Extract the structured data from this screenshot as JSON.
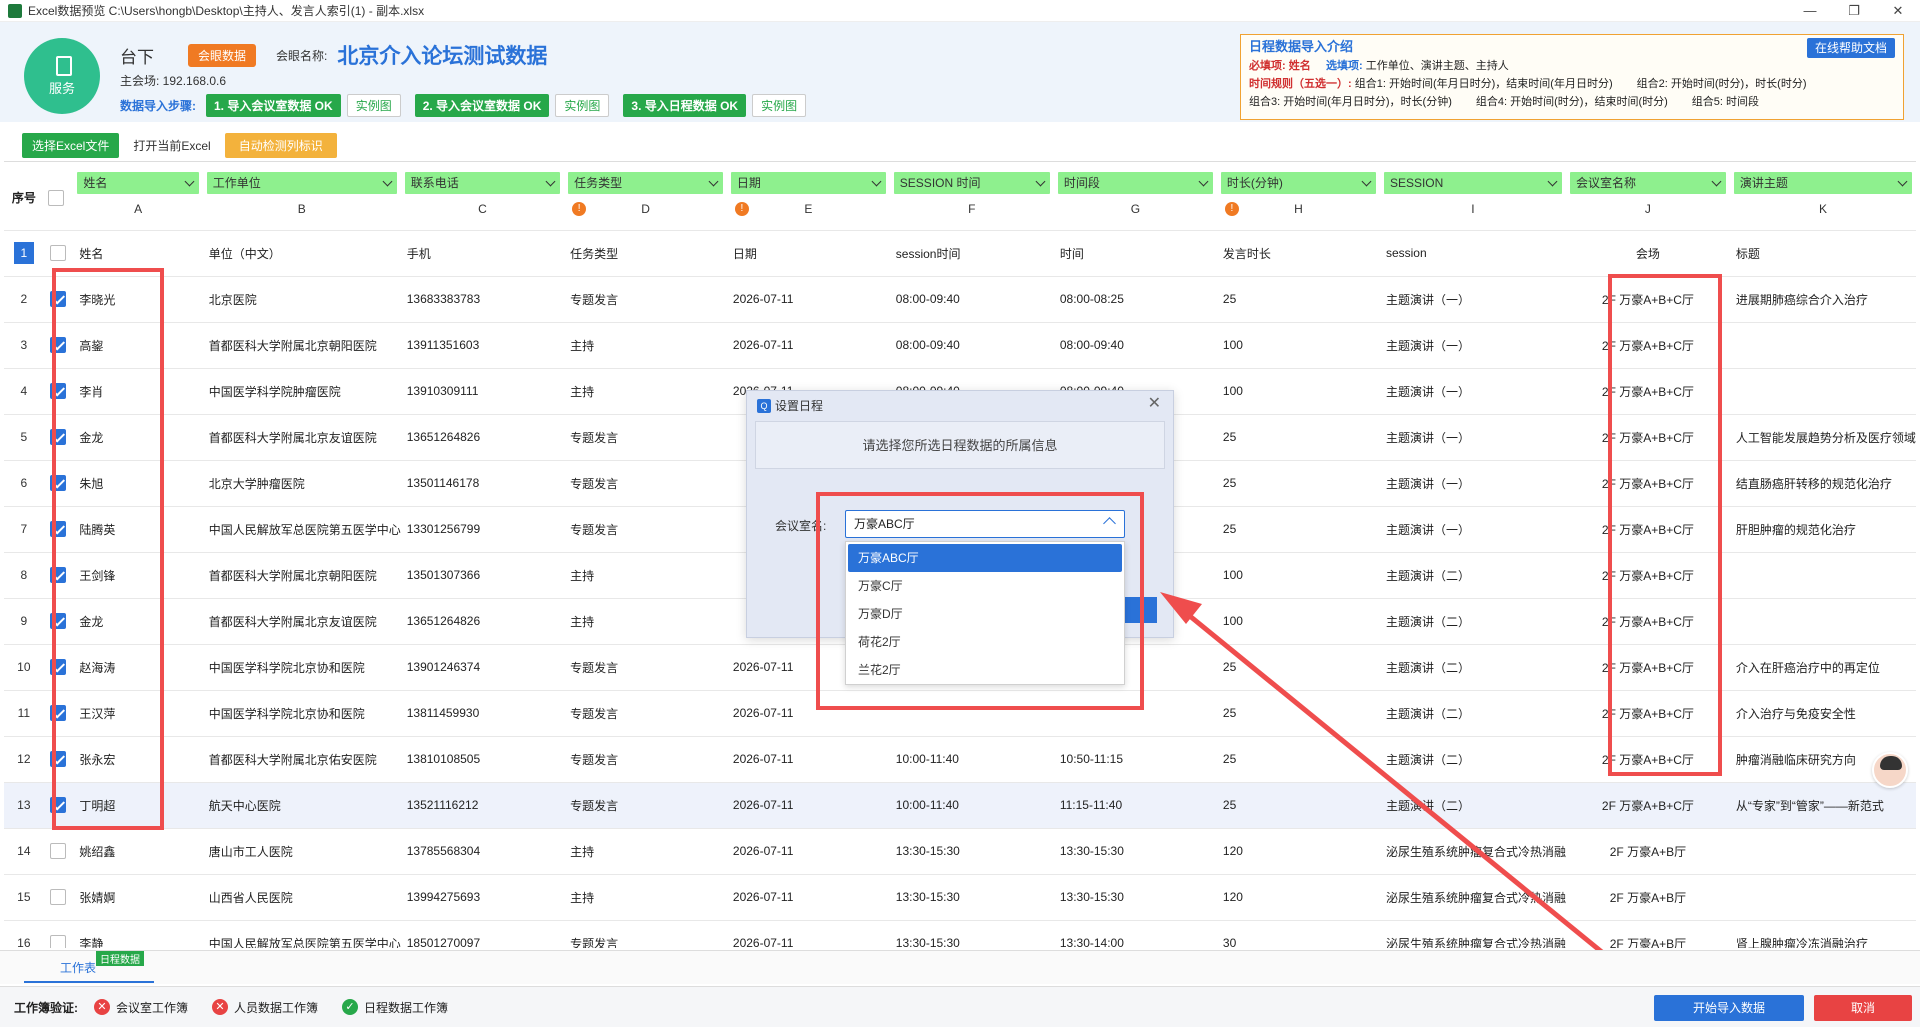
{
  "titlebar": {
    "title": "Excel数据预览 C:\\Users\\hongb\\Desktop\\主持人、发言人索引(1) - 副本.xlsx",
    "min": "—",
    "max": "❐",
    "close": "✕"
  },
  "header": {
    "service": "服务",
    "stage": "台下",
    "tag": "会眼数据",
    "conf_label": "会眼名称:",
    "conf_name": "北京介入论坛测试数据",
    "host": "主会场: 192.168.0.6",
    "steps_label": "数据导入步骤:",
    "step1": "1. 导入会议室数据 OK",
    "step2": "2. 导入会议室数据 OK",
    "step3": "3. 导入日程数据 OK",
    "example": "实例图"
  },
  "intro": {
    "title": "日程数据导入介绍",
    "help": "在线帮助文档",
    "req_label": "必填项:",
    "req": "姓名",
    "opt_label": "选填项:",
    "opt": "工作单位、演讲主题、主持人",
    "rule_label": "时间规则（五选一）:",
    "c1": "组合1: 开始时间(年月日时分)，结束时间(年月日时分)",
    "c2": "组合2: 开始时间(时分)，时长(时分)",
    "c3": "组合3: 开始时间(年月日时分)，时长(分钟)",
    "c4": "组合4: 开始时间(时分)，结束时间(时分)",
    "c5": "组合5: 时间段"
  },
  "toolbar": {
    "select_excel": "选择Excel文件",
    "open_excel": "打开当前Excel",
    "auto_detect": "自动检测列标识"
  },
  "table": {
    "seq_header": "序号",
    "columns": [
      {
        "field": "姓名",
        "letter": "A",
        "warn": false
      },
      {
        "field": "工作单位",
        "letter": "B",
        "warn": false
      },
      {
        "field": "联系电话",
        "letter": "C",
        "warn": false
      },
      {
        "field": "任务类型",
        "letter": "D",
        "warn": true
      },
      {
        "field": "日期",
        "letter": "E",
        "warn": true
      },
      {
        "field": "SESSION 时间",
        "letter": "F",
        "warn": false
      },
      {
        "field": "时间段",
        "letter": "G",
        "warn": false
      },
      {
        "field": "时长(分钟)",
        "letter": "H",
        "warn": true
      },
      {
        "field": "SESSION",
        "letter": "I",
        "warn": false
      },
      {
        "field": "会议室名称",
        "letter": "J",
        "warn": false
      },
      {
        "field": "演讲主题",
        "letter": "K",
        "warn": false
      }
    ],
    "rows": [
      {
        "n": "1",
        "checked": false,
        "cells": [
          "姓名",
          "单位（中文）",
          "手机",
          "任务类型",
          "日期",
          "session时间",
          "时间",
          "发言时长",
          "session",
          "会场",
          "标题"
        ]
      },
      {
        "n": "2",
        "checked": true,
        "cells": [
          "李晓光",
          "北京医院",
          "13683383783",
          "专题发言",
          "2026-07-11",
          "08:00-09:40",
          "08:00-08:25",
          "25",
          "主题演讲（一）",
          "2F 万豪A+B+C厅",
          "进展期肺癌综合介入治疗"
        ]
      },
      {
        "n": "3",
        "checked": true,
        "cells": [
          "高鋆",
          "首都医科大学附属北京朝阳医院",
          "13911351603",
          "主持",
          "2026-07-11",
          "08:00-09:40",
          "08:00-09:40",
          "100",
          "主题演讲（一）",
          "2F 万豪A+B+C厅",
          ""
        ]
      },
      {
        "n": "4",
        "checked": true,
        "cells": [
          "李肖",
          "中国医学科学院肿瘤医院",
          "13910309111",
          "主持",
          "2026-07-11",
          "08:00-09:40",
          "08:00-09:40",
          "100",
          "主题演讲（一）",
          "2F 万豪A+B+C厅",
          ""
        ]
      },
      {
        "n": "5",
        "checked": true,
        "cells": [
          "金龙",
          "首都医科大学附属北京友谊医院",
          "13651264826",
          "专题发言",
          "",
          "",
          "",
          "25",
          "主题演讲（一）",
          "2F 万豪A+B+C厅",
          "人工智能发展趋势分析及医疗领域"
        ]
      },
      {
        "n": "6",
        "checked": true,
        "cells": [
          "朱旭",
          "北京大学肿瘤医院",
          "13501146178",
          "专题发言",
          "",
          "",
          "",
          "25",
          "主题演讲（一）",
          "2F 万豪A+B+C厅",
          "结直肠癌肝转移的规范化治疗"
        ]
      },
      {
        "n": "7",
        "checked": true,
        "cells": [
          "陆腾英",
          "中国人民解放军总医院第五医学中心",
          "13301256799",
          "专题发言",
          "",
          "",
          "",
          "25",
          "主题演讲（一）",
          "2F 万豪A+B+C厅",
          "肝胆肿瘤的规范化治疗"
        ]
      },
      {
        "n": "8",
        "checked": true,
        "cells": [
          "王剑锋",
          "首都医科大学附属北京朝阳医院",
          "13501307366",
          "主持",
          "",
          "",
          "",
          "100",
          "主题演讲（二）",
          "2F 万豪A+B+C厅",
          ""
        ]
      },
      {
        "n": "9",
        "checked": true,
        "cells": [
          "金龙",
          "首都医科大学附属北京友谊医院",
          "13651264826",
          "主持",
          "",
          "",
          "",
          "100",
          "主题演讲（二）",
          "2F 万豪A+B+C厅",
          ""
        ]
      },
      {
        "n": "10",
        "checked": true,
        "cells": [
          "赵海涛",
          "中国医学科学院北京协和医院",
          "13901246374",
          "专题发言",
          "2026-07-11",
          "",
          "",
          "25",
          "主题演讲（二）",
          "2F 万豪A+B+C厅",
          "介入在肝癌治疗中的再定位"
        ]
      },
      {
        "n": "11",
        "checked": true,
        "cells": [
          "王汉萍",
          "中国医学科学院北京协和医院",
          "13811459930",
          "专题发言",
          "2026-07-11",
          "",
          "",
          "25",
          "主题演讲（二）",
          "2F 万豪A+B+C厅",
          "介入治疗与免疫安全性"
        ]
      },
      {
        "n": "12",
        "checked": true,
        "cells": [
          "张永宏",
          "首都医科大学附属北京佑安医院",
          "13810108505",
          "专题发言",
          "2026-07-11",
          "10:00-11:40",
          "10:50-11:15",
          "25",
          "主题演讲（二）",
          "2F 万豪A+B+C厅",
          "肿瘤消融临床研究方向"
        ]
      },
      {
        "n": "13",
        "checked": true,
        "cells": [
          "丁明超",
          "航天中心医院",
          "13521116212",
          "专题发言",
          "2026-07-11",
          "10:00-11:40",
          "11:15-11:40",
          "25",
          "主题演讲（二）",
          "2F 万豪A+B+C厅",
          "从“专家”到“管家”——新范式"
        ]
      },
      {
        "n": "14",
        "checked": false,
        "cells": [
          "姚绍鑫",
          "唐山市工人医院",
          "13785568304",
          "主持",
          "2026-07-11",
          "13:30-15:30",
          "13:30-15:30",
          "120",
          "泌尿生殖系统肿瘤复合式冷热消融",
          "2F 万豪A+B厅",
          ""
        ]
      },
      {
        "n": "15",
        "checked": false,
        "cells": [
          "张婧婀",
          "山西省人民医院",
          "13994275693",
          "主持",
          "2026-07-11",
          "13:30-15:30",
          "13:30-15:30",
          "120",
          "泌尿生殖系统肿瘤复合式冷热消融",
          "2F 万豪A+B厅",
          ""
        ]
      },
      {
        "n": "16",
        "checked": false,
        "cells": [
          "李静",
          "中国人民解放军总医院第五医学中心",
          "18501270097",
          "专题发言",
          "2026-07-11",
          "13:30-15:30",
          "13:30-14:00",
          "30",
          "泌尿生殖系统肿瘤复合式冷热消融",
          "2F 万豪A+B厅",
          "肾上腺肿瘤冷冻消融治疗"
        ]
      }
    ]
  },
  "dialog": {
    "title": "设置日程",
    "message": "请选择您所选日程数据的所属信息",
    "field_label": "会议室名:",
    "selected": "万豪ABC厅",
    "options": [
      "万豪ABC厅",
      "万豪C厅",
      "万豪D厅",
      "荷花2厅",
      "兰花2厅"
    ]
  },
  "sheet": {
    "tab": "工作表",
    "badge": "日程数据"
  },
  "bottom": {
    "label": "工作簿验证:",
    "v1": "会议室工作簿",
    "v2": "人员数据工作簿",
    "v3": "日程数据工作簿",
    "import": "开始导入数据",
    "cancel": "取消"
  }
}
